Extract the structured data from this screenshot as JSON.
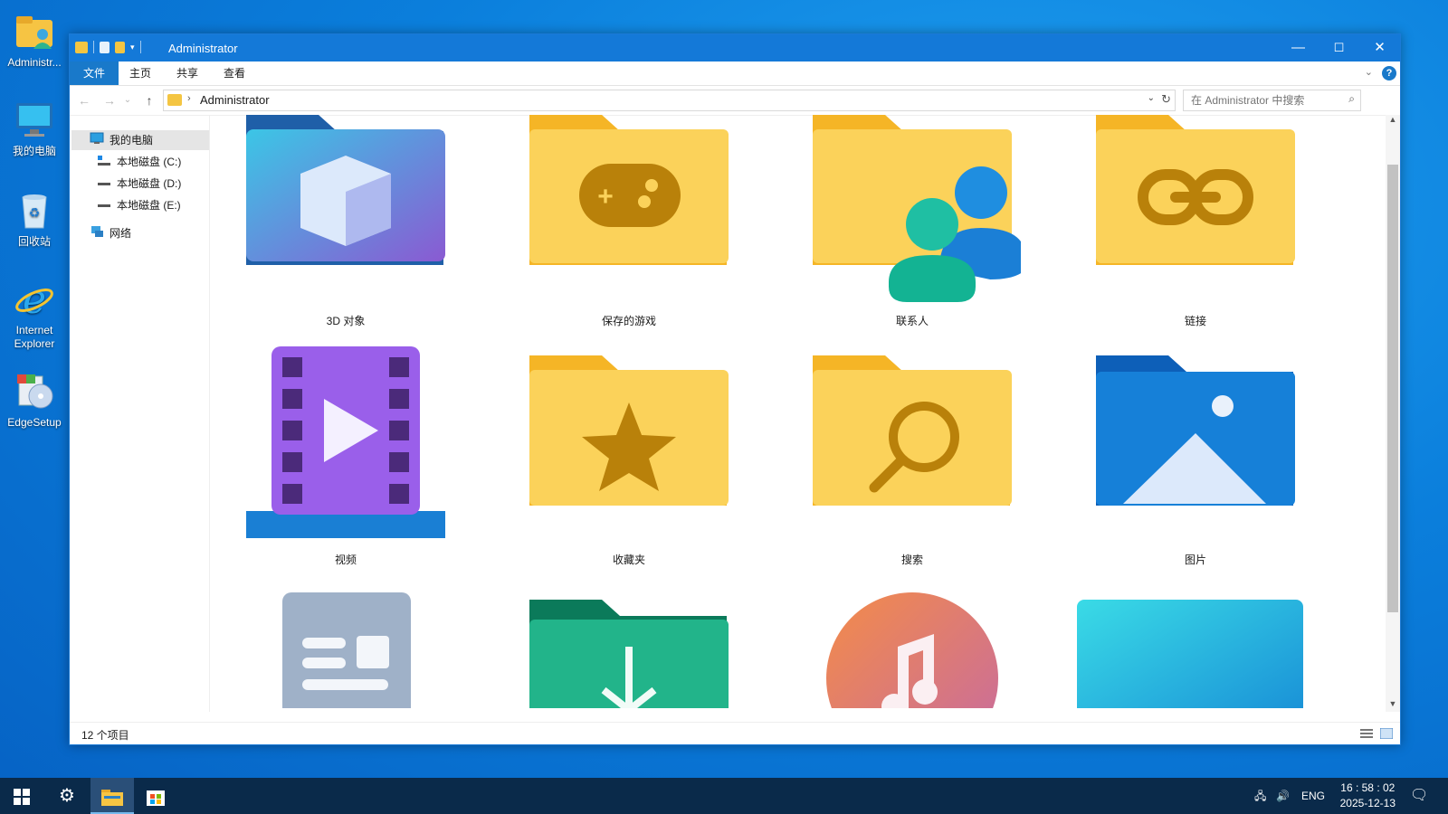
{
  "desktop": {
    "icons": [
      {
        "label": "Administr...",
        "icon": "user-folder-icon"
      },
      {
        "label": "我的电脑",
        "icon": "computer-icon"
      },
      {
        "label": "回收站",
        "icon": "recycle-bin-icon"
      },
      {
        "label": "Internet Explorer",
        "icon": "ie-icon"
      },
      {
        "label": "EdgeSetup",
        "icon": "installer-icon"
      }
    ]
  },
  "window": {
    "title": "Administrator",
    "ribbon_tabs": [
      "文件",
      "主页",
      "共享",
      "查看"
    ],
    "address_path": "Administrator",
    "search_placeholder": "在 Administrator 中搜索"
  },
  "nav": {
    "items": [
      {
        "label": "我的电脑",
        "selected": true
      },
      {
        "label": "本地磁盘 (C:)"
      },
      {
        "label": "本地磁盘 (D:)"
      },
      {
        "label": "本地磁盘 (E:)"
      },
      {
        "label": "网络"
      }
    ]
  },
  "content": {
    "tiles": [
      {
        "label": "3D 对象",
        "icon": "3d-objects-folder-icon"
      },
      {
        "label": "保存的游戏",
        "icon": "saved-games-folder-icon"
      },
      {
        "label": "联系人",
        "icon": "contacts-folder-icon"
      },
      {
        "label": "链接",
        "icon": "links-folder-icon"
      },
      {
        "label": "视频",
        "icon": "videos-folder-icon"
      },
      {
        "label": "收藏夹",
        "icon": "favorites-folder-icon"
      },
      {
        "label": "搜索",
        "icon": "searches-folder-icon"
      },
      {
        "label": "图片",
        "icon": "pictures-folder-icon"
      },
      {
        "label": "",
        "icon": "documents-folder-icon"
      },
      {
        "label": "",
        "icon": "downloads-folder-icon"
      },
      {
        "label": "",
        "icon": "music-folder-icon"
      },
      {
        "label": "",
        "icon": "desktop-folder-icon"
      }
    ]
  },
  "status": {
    "count": "12 个项目"
  },
  "taskbar": {
    "language": "ENG",
    "time": "16 : 58 : 02",
    "date": "2025-12-13"
  },
  "colors": {
    "titlebar": "#1479d8",
    "folder_yellow": "#f9c93f",
    "accent": "#1979ca"
  }
}
